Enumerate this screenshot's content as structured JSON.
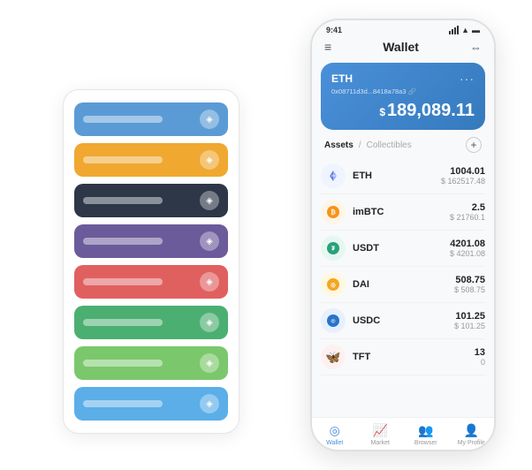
{
  "scene": {
    "background": "#ffffff"
  },
  "cardStack": {
    "items": [
      {
        "color": "card-blue",
        "icon": "◈"
      },
      {
        "color": "card-orange",
        "icon": "◈"
      },
      {
        "color": "card-dark",
        "icon": "◈"
      },
      {
        "color": "card-purple",
        "icon": "◈"
      },
      {
        "color": "card-red",
        "icon": "◈"
      },
      {
        "color": "card-green",
        "icon": "◈"
      },
      {
        "color": "card-light-green",
        "icon": "◈"
      },
      {
        "color": "card-sky",
        "icon": "◈"
      }
    ]
  },
  "phone": {
    "statusBar": {
      "time": "9:41",
      "icons": "▲▲ ☁ 🔋"
    },
    "topNav": {
      "menuIcon": "≡",
      "title": "Wallet",
      "expandIcon": "⇔"
    },
    "ethCard": {
      "label": "ETH",
      "dots": "···",
      "address": "0x08711d3d...8418a78a3 🔗",
      "currencySymbol": "$",
      "amount": "189,089.11"
    },
    "assets": {
      "activeTab": "Assets",
      "divider": "/",
      "inactiveTab": "Collectibles",
      "addLabel": "+"
    },
    "assetList": [
      {
        "symbol": "ETH",
        "icon": "◈",
        "iconClass": "asset-icon-eth",
        "amount": "1004.01",
        "usdValue": "$ 162517.48"
      },
      {
        "symbol": "imBTC",
        "icon": "₿",
        "iconClass": "asset-icon-imbtc",
        "amount": "2.5",
        "usdValue": "$ 21760.1"
      },
      {
        "symbol": "USDT",
        "icon": "₮",
        "iconClass": "asset-icon-usdt",
        "amount": "4201.08",
        "usdValue": "$ 4201.08"
      },
      {
        "symbol": "DAI",
        "icon": "◎",
        "iconClass": "asset-icon-dai",
        "amount": "508.75",
        "usdValue": "$ 508.75"
      },
      {
        "symbol": "USDC",
        "icon": "©",
        "iconClass": "asset-icon-usdc",
        "amount": "101.25",
        "usdValue": "$ 101.25"
      },
      {
        "symbol": "TFT",
        "icon": "🦋",
        "iconClass": "asset-icon-tft",
        "amount": "13",
        "usdValue": "0"
      }
    ],
    "bottomNav": [
      {
        "id": "wallet",
        "icon": "◎",
        "label": "Wallet",
        "active": true
      },
      {
        "id": "market",
        "icon": "📈",
        "label": "Market",
        "active": false
      },
      {
        "id": "browser",
        "icon": "🔍",
        "label": "Browser",
        "active": false
      },
      {
        "id": "profile",
        "icon": "👤",
        "label": "My Profile",
        "active": false
      }
    ]
  }
}
